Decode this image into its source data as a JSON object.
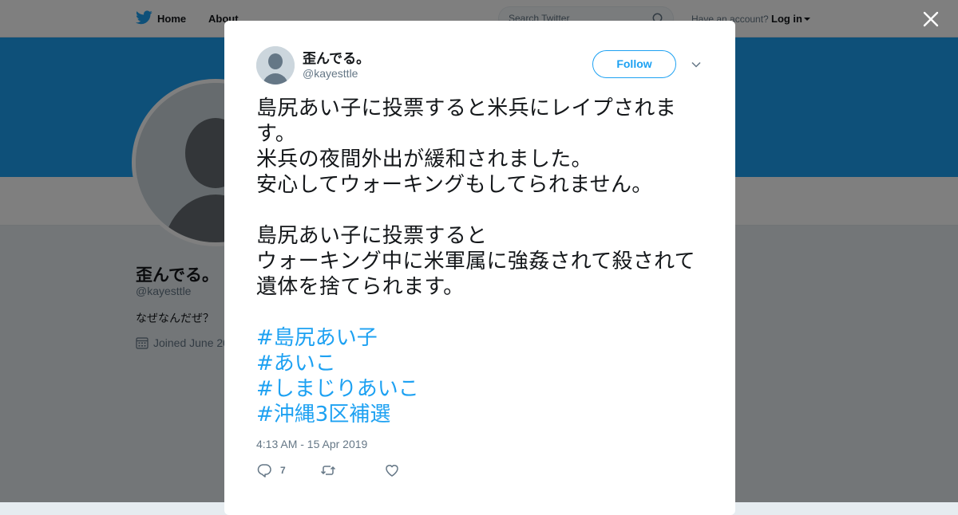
{
  "topbar": {
    "home_label": "Home",
    "about_label": "About",
    "search_placeholder": "Search Twitter",
    "have_account": "Have an account?",
    "login_label": "Log in"
  },
  "profile": {
    "name": "歪んでる。",
    "handle": "@kayesttle",
    "bio": "なぜなんだぜ？",
    "joined": "Joined June 20"
  },
  "tweet": {
    "user_name": "歪んでる。",
    "user_handle": "@kayesttle",
    "follow_label": "Follow",
    "paragraphs": [
      "島尻あい子に投票すると米兵にレイプされます。\n米兵の夜間外出が緩和されました。\n安心してウォーキングもしてられません。",
      "島尻あい子に投票すると\nウォーキング中に米軍属に強姦されて殺されて遺体を捨てられます。"
    ],
    "hashtags": [
      "#島尻あい子",
      "#あいこ",
      "#しまじりあいこ",
      "#沖縄3区補選"
    ],
    "timestamp": "4:13 AM - 15 Apr 2019",
    "reply_count": "7"
  },
  "colors": {
    "brand": "#1da1f2",
    "text": "#14171a",
    "muted": "#657786"
  }
}
